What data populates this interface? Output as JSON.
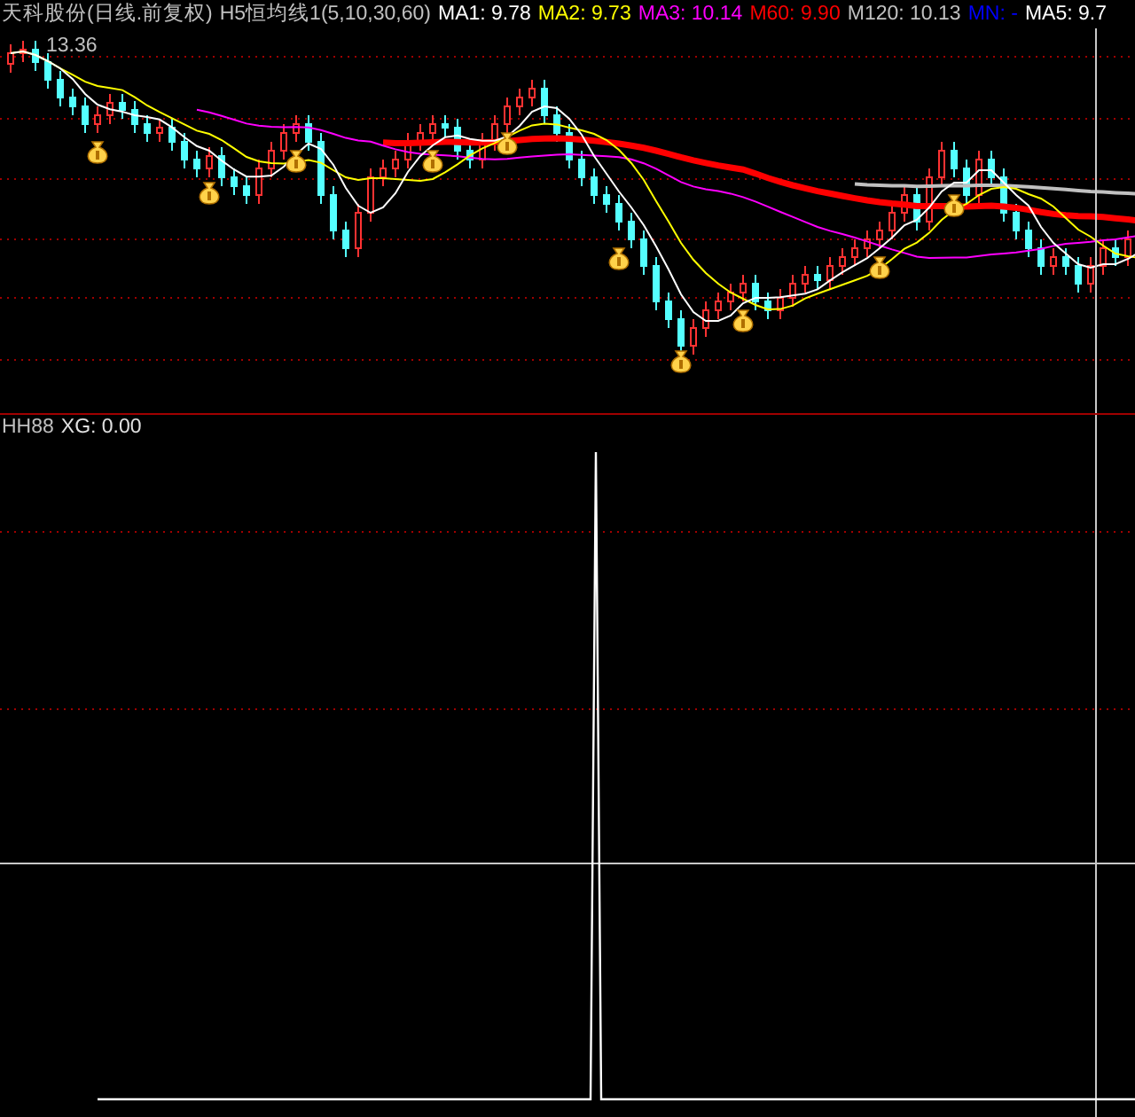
{
  "header": {
    "stock_title": "天科股份(日线.前复权)",
    "indicator": "H5恒均线1(5,10,30,60)",
    "legend": [
      {
        "label": "MA1:",
        "value": "9.78",
        "color": "#ffffff"
      },
      {
        "label": "MA2:",
        "value": "9.73",
        "color": "#ffff00"
      },
      {
        "label": "MA3:",
        "value": "10.14",
        "color": "#ff00ff"
      },
      {
        "label": "M60:",
        "value": "9.90",
        "color": "#ff0000"
      },
      {
        "label": "M120:",
        "value": "10.13",
        "color": "#c0c0c0"
      },
      {
        "label": "MN:",
        "value": "-",
        "color": "#0000ff"
      },
      {
        "label": "MA5:",
        "value": "9.7",
        "color": "#ffffff"
      }
    ]
  },
  "price_label": "13.36",
  "lower_panel": {
    "title": "HH88",
    "readout": "XG: 0.00"
  }
}
